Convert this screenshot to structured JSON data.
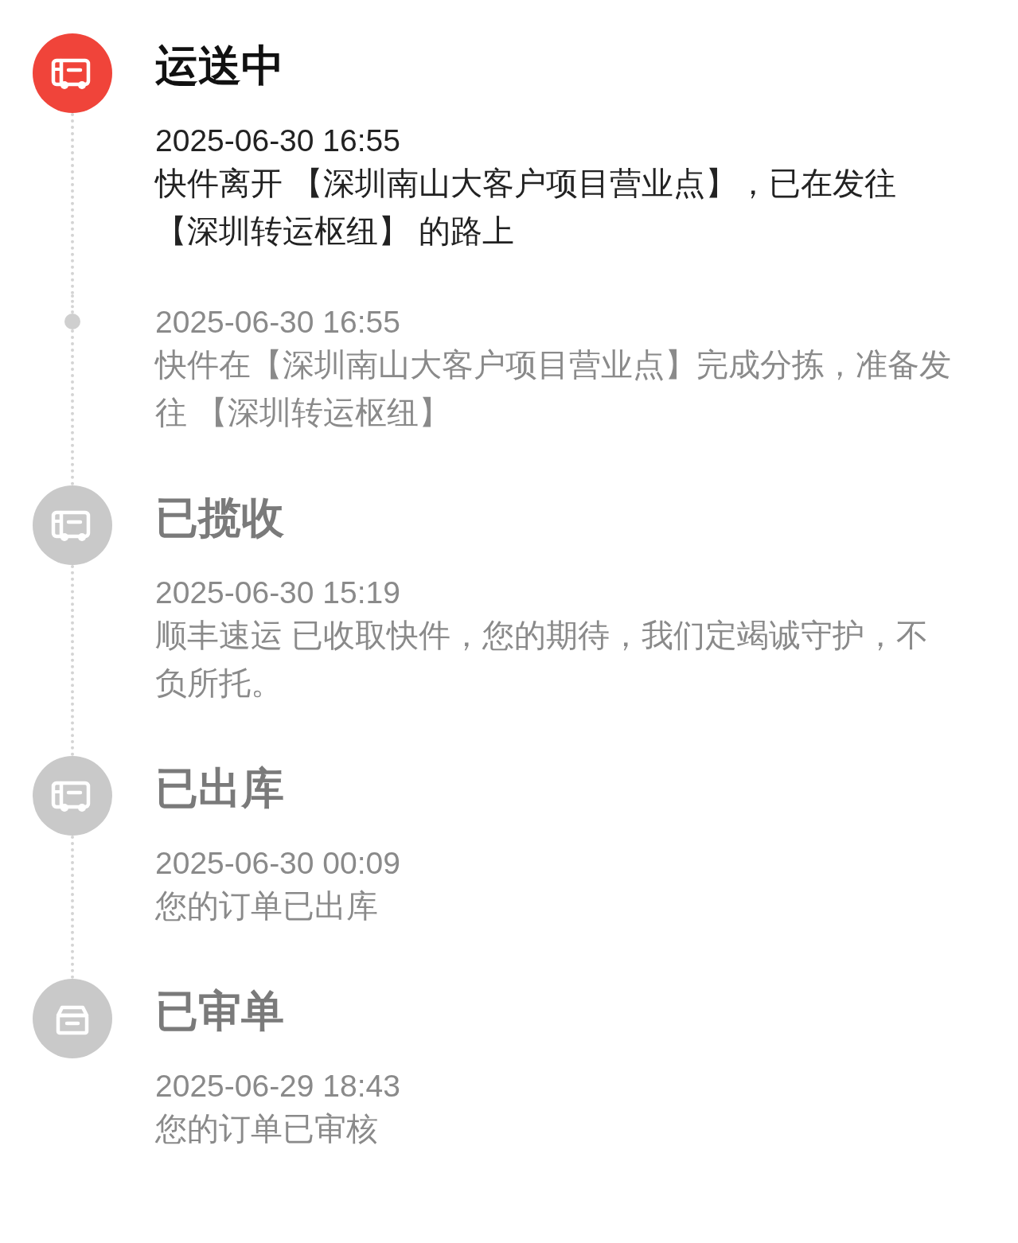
{
  "stages": [
    {
      "title": "运送中",
      "kind": "truck",
      "active": true,
      "events": [
        {
          "time": "2025-06-30 16:55",
          "text": "快件离开 【深圳南山大客户项目营业点】，已在发往【深圳转运枢纽】 的路上"
        },
        {
          "time": "2025-06-30 16:55",
          "text": "快件在【深圳南山大客户项目营业点】完成分拣，准备发往 【深圳转运枢纽】"
        }
      ]
    },
    {
      "title": "已揽收",
      "kind": "truck",
      "active": false,
      "events": [
        {
          "time": "2025-06-30 15:19",
          "text": "顺丰速运 已收取快件，您的期待，我们定竭诚守护，不负所托。"
        }
      ]
    },
    {
      "title": "已出库",
      "kind": "truck",
      "active": false,
      "events": [
        {
          "time": "2025-06-30 00:09",
          "text": "您的订单已出库"
        }
      ]
    },
    {
      "title": "已审单",
      "kind": "box",
      "active": false,
      "events": [
        {
          "time": "2025-06-29 18:43",
          "text": "您的订单已审核"
        }
      ]
    }
  ]
}
